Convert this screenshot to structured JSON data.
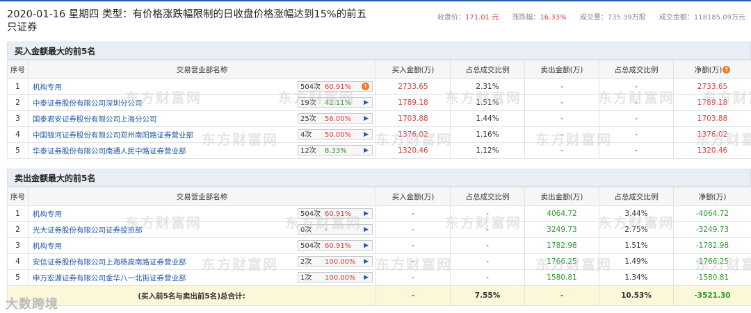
{
  "header": {
    "title": "2020-01-16 星期四  类型：有价格涨跌幅限制的日收盘价格涨幅达到15%的前五只证券",
    "close_label": "收盘价：",
    "close_value": "171.01 元",
    "change_label": "涨跌幅：",
    "change_value": "16.33%",
    "volume_label": "成交量：",
    "volume_value": "735.39万股",
    "amount_label": "成交金额：",
    "amount_value": "118185.09万元"
  },
  "buy_section": {
    "heading": "买入金额最大的前5名",
    "columns": [
      "序号",
      "交易营业部名称",
      "买入金额(万)",
      "占总成交比例",
      "卖出金额(万)",
      "占总成交比例",
      "净额(万)"
    ],
    "rows": [
      {
        "no": "1",
        "name": "机构专用",
        "count": "504次",
        "pct": "60.91%",
        "icon": "warning-icon",
        "buy": "2733.65",
        "buy_ratio": "2.31%",
        "sell": "-",
        "sell_ratio": "-",
        "net": "2733.65"
      },
      {
        "no": "2",
        "name": "中泰证券股份有限公司深圳分公司",
        "count": "19次",
        "pct": "42.11%",
        "icon": "arrow-icon",
        "buy": "1789.18",
        "buy_ratio": "1.51%",
        "sell": "-",
        "sell_ratio": "-",
        "net": "1789.18"
      },
      {
        "no": "3",
        "name": "国泰君安证券股份有限公司上海分公司",
        "count": "25次",
        "pct": "56.00%",
        "icon": "arrow-icon",
        "buy": "1703.88",
        "buy_ratio": "1.44%",
        "sell": "-",
        "sell_ratio": "-",
        "net": "1703.88"
      },
      {
        "no": "4",
        "name": "中国银河证券股份有限公司郑州南阳路证券营业部",
        "count": "4次",
        "pct": "50.00%",
        "icon": "arrow-icon",
        "buy": "1376.02",
        "buy_ratio": "1.16%",
        "sell": "-",
        "sell_ratio": "-",
        "net": "1376.02"
      },
      {
        "no": "5",
        "name": "华泰证券股份有限公司南通人民中路证券营业部",
        "count": "12次",
        "pct": "8.33%",
        "icon": "arrow-icon",
        "buy": "1320.46",
        "buy_ratio": "1.12%",
        "sell": "-",
        "sell_ratio": "-",
        "net": "1320.46"
      }
    ]
  },
  "sell_section": {
    "heading": "卖出金额最大的前5名",
    "columns": [
      "序号",
      "交易营业部名称",
      "买入金额(万)",
      "占总成交比例",
      "卖出金额(万)",
      "占总成交比例",
      "净额(万)"
    ],
    "rows": [
      {
        "no": "1",
        "name": "机构专用",
        "count": "504次",
        "pct": "60.91%",
        "buy": "-",
        "buy_ratio": "-",
        "sell": "4064.72",
        "sell_ratio": "3.44%",
        "net": "-4064.72"
      },
      {
        "no": "2",
        "name": "光大证券股份有限公司证券投资部",
        "count": "0次",
        "pct": "-",
        "buy": "-",
        "buy_ratio": "-",
        "sell": "3249.73",
        "sell_ratio": "2.75%",
        "net": "-3249.73"
      },
      {
        "no": "3",
        "name": "机构专用",
        "count": "504次",
        "pct": "60.91%",
        "buy": "-",
        "buy_ratio": "-",
        "sell": "1782.98",
        "sell_ratio": "1.51%",
        "net": "-1782.98"
      },
      {
        "no": "4",
        "name": "安信证券股份有限公司上海杨高南路证券营业部",
        "count": "2次",
        "pct": "100.00%",
        "buy": "-",
        "buy_ratio": "-",
        "sell": "1766.25",
        "sell_ratio": "1.49%",
        "net": "-1766.25"
      },
      {
        "no": "5",
        "name": "申万宏源证券有限公司金华八一北街证券营业部",
        "count": "1次",
        "pct": "100.00%",
        "buy": "-",
        "buy_ratio": "-",
        "sell": "1580.81",
        "sell_ratio": "1.34%",
        "net": "-1580.81"
      }
    ]
  },
  "total": {
    "label": "(买入前5名与卖出前5名)总合计:",
    "buy": "-",
    "buy_ratio": "7.55%",
    "sell": "-",
    "sell_ratio": "10.53%",
    "net": "-3521.30"
  },
  "watermark": "东方财富网",
  "watermark_sub": "eastmoney.com",
  "brand": "大数跨境",
  "colors": {
    "accent": "#1f5aa6",
    "up": "#e23b3b",
    "down": "#2a9a2a",
    "warn": "#f47a20"
  }
}
